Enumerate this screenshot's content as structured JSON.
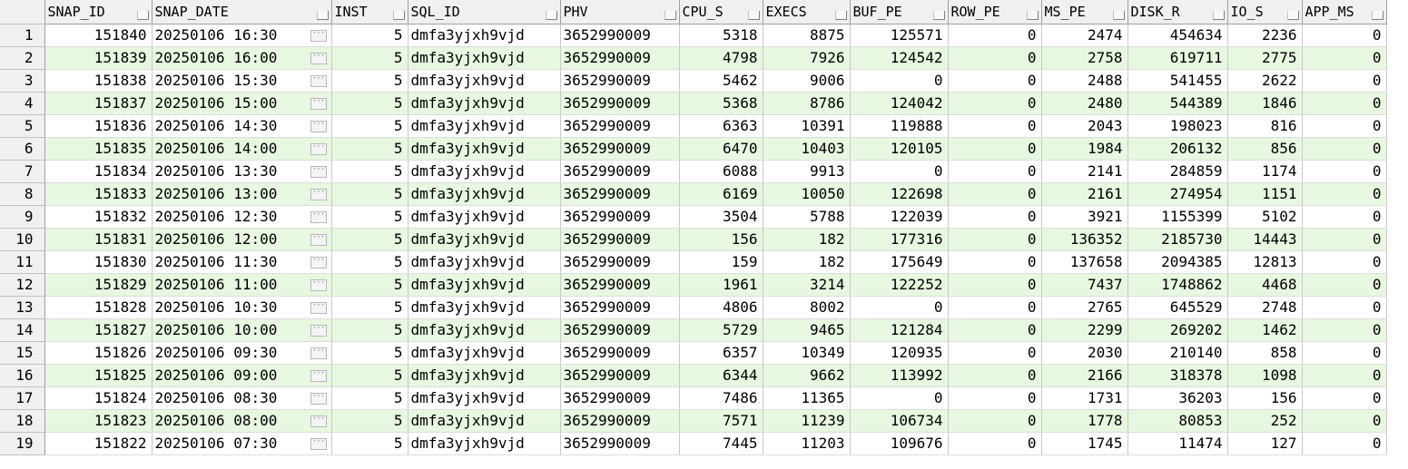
{
  "columns": [
    {
      "key": "row",
      "label": ""
    },
    {
      "key": "snap_id",
      "label": "SNAP_ID"
    },
    {
      "key": "snap_date",
      "label": "SNAP_DATE"
    },
    {
      "key": "inst",
      "label": "INST"
    },
    {
      "key": "sql_id",
      "label": "SQL_ID"
    },
    {
      "key": "phv",
      "label": "PHV"
    },
    {
      "key": "cpu_s",
      "label": "CPU_S"
    },
    {
      "key": "execs",
      "label": "EXECS"
    },
    {
      "key": "buf_pe",
      "label": "BUF_PE"
    },
    {
      "key": "row_pe",
      "label": "ROW_PE"
    },
    {
      "key": "ms_pe",
      "label": "MS_PE"
    },
    {
      "key": "disk_r",
      "label": "DISK_R"
    },
    {
      "key": "io_s",
      "label": "IO_S"
    },
    {
      "key": "app_ms",
      "label": "APP_MS"
    }
  ],
  "ellipsis_glyph": "···",
  "rows": [
    [
      "1",
      "151840",
      "20250106 16:30",
      "5",
      "dmfa3yjxh9vjd",
      "3652990009",
      "5318",
      "8875",
      "125571",
      "0",
      "2474",
      "454634",
      "2236",
      "0"
    ],
    [
      "2",
      "151839",
      "20250106 16:00",
      "5",
      "dmfa3yjxh9vjd",
      "3652990009",
      "4798",
      "7926",
      "124542",
      "0",
      "2758",
      "619711",
      "2775",
      "0"
    ],
    [
      "3",
      "151838",
      "20250106 15:30",
      "5",
      "dmfa3yjxh9vjd",
      "3652990009",
      "5462",
      "9006",
      "0",
      "0",
      "2488",
      "541455",
      "2622",
      "0"
    ],
    [
      "4",
      "151837",
      "20250106 15:00",
      "5",
      "dmfa3yjxh9vjd",
      "3652990009",
      "5368",
      "8786",
      "124042",
      "0",
      "2480",
      "544389",
      "1846",
      "0"
    ],
    [
      "5",
      "151836",
      "20250106 14:30",
      "5",
      "dmfa3yjxh9vjd",
      "3652990009",
      "6363",
      "10391",
      "119888",
      "0",
      "2043",
      "198023",
      "816",
      "0"
    ],
    [
      "6",
      "151835",
      "20250106 14:00",
      "5",
      "dmfa3yjxh9vjd",
      "3652990009",
      "6470",
      "10403",
      "120105",
      "0",
      "1984",
      "206132",
      "856",
      "0"
    ],
    [
      "7",
      "151834",
      "20250106 13:30",
      "5",
      "dmfa3yjxh9vjd",
      "3652990009",
      "6088",
      "9913",
      "0",
      "0",
      "2141",
      "284859",
      "1174",
      "0"
    ],
    [
      "8",
      "151833",
      "20250106 13:00",
      "5",
      "dmfa3yjxh9vjd",
      "3652990009",
      "6169",
      "10050",
      "122698",
      "0",
      "2161",
      "274954",
      "1151",
      "0"
    ],
    [
      "9",
      "151832",
      "20250106 12:30",
      "5",
      "dmfa3yjxh9vjd",
      "3652990009",
      "3504",
      "5788",
      "122039",
      "0",
      "3921",
      "1155399",
      "5102",
      "0"
    ],
    [
      "10",
      "151831",
      "20250106 12:00",
      "5",
      "dmfa3yjxh9vjd",
      "3652990009",
      "156",
      "182",
      "177316",
      "0",
      "136352",
      "2185730",
      "14443",
      "0"
    ],
    [
      "11",
      "151830",
      "20250106 11:30",
      "5",
      "dmfa3yjxh9vjd",
      "3652990009",
      "159",
      "182",
      "175649",
      "0",
      "137658",
      "2094385",
      "12813",
      "0"
    ],
    [
      "12",
      "151829",
      "20250106 11:00",
      "5",
      "dmfa3yjxh9vjd",
      "3652990009",
      "1961",
      "3214",
      "122252",
      "0",
      "7437",
      "1748862",
      "4468",
      "0"
    ],
    [
      "13",
      "151828",
      "20250106 10:30",
      "5",
      "dmfa3yjxh9vjd",
      "3652990009",
      "4806",
      "8002",
      "0",
      "0",
      "2765",
      "645529",
      "2748",
      "0"
    ],
    [
      "14",
      "151827",
      "20250106 10:00",
      "5",
      "dmfa3yjxh9vjd",
      "3652990009",
      "5729",
      "9465",
      "121284",
      "0",
      "2299",
      "269202",
      "1462",
      "0"
    ],
    [
      "15",
      "151826",
      "20250106 09:30",
      "5",
      "dmfa3yjxh9vjd",
      "3652990009",
      "6357",
      "10349",
      "120935",
      "0",
      "2030",
      "210140",
      "858",
      "0"
    ],
    [
      "16",
      "151825",
      "20250106 09:00",
      "5",
      "dmfa3yjxh9vjd",
      "3652990009",
      "6344",
      "9662",
      "113992",
      "0",
      "2166",
      "318378",
      "1098",
      "0"
    ],
    [
      "17",
      "151824",
      "20250106 08:30",
      "5",
      "dmfa3yjxh9vjd",
      "3652990009",
      "7486",
      "11365",
      "0",
      "0",
      "1731",
      "36203",
      "156",
      "0"
    ],
    [
      "18",
      "151823",
      "20250106 08:00",
      "5",
      "dmfa3yjxh9vjd",
      "3652990009",
      "7571",
      "11239",
      "106734",
      "0",
      "1778",
      "80853",
      "252",
      "0"
    ],
    [
      "19",
      "151822",
      "20250106 07:30",
      "5",
      "dmfa3yjxh9vjd",
      "3652990009",
      "7445",
      "11203",
      "109676",
      "0",
      "1745",
      "11474",
      "127",
      "0"
    ]
  ]
}
